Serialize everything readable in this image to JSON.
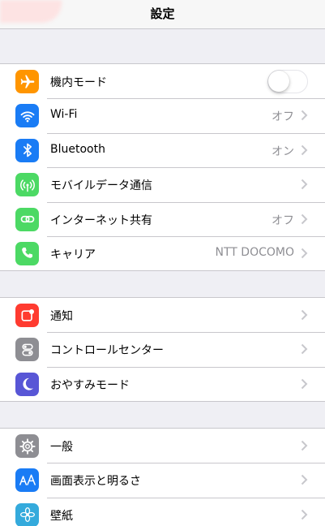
{
  "nav": {
    "title": "設定"
  },
  "colors": {
    "orange": "#ff9500",
    "blue": "#1a7cf5",
    "green": "#4cd964",
    "red": "#ff3b30",
    "gray": "#8e8e93",
    "purple": "#5856d6",
    "group_bg": "#efeff4",
    "value_gray": "#8e8e93"
  },
  "groups": [
    {
      "rows": [
        {
          "label": "機内モード",
          "icon": "airplane-icon",
          "control": "toggle",
          "toggle_on": false
        },
        {
          "label": "Wi-Fi",
          "icon": "wifi-icon",
          "value": "オフ"
        },
        {
          "label": "Bluetooth",
          "icon": "bluetooth-icon",
          "value": "オン"
        },
        {
          "label": "モバイルデータ通信",
          "icon": "antenna-icon",
          "value": ""
        },
        {
          "label": "インターネット共有",
          "icon": "link-icon",
          "value": "オフ"
        },
        {
          "label": "キャリア",
          "icon": "phone-icon",
          "value": "NTT DOCOMO"
        }
      ]
    },
    {
      "rows": [
        {
          "label": "通知",
          "icon": "notification-icon",
          "value": ""
        },
        {
          "label": "コントロールセンター",
          "icon": "switches-icon",
          "value": ""
        },
        {
          "label": "おやすみモード",
          "icon": "moon-icon",
          "value": ""
        }
      ]
    },
    {
      "rows": [
        {
          "label": "一般",
          "icon": "gear-icon",
          "value": ""
        },
        {
          "label": "画面表示と明るさ",
          "icon": "text-size-icon",
          "value": ""
        },
        {
          "label": "壁紙",
          "icon": "flower-icon",
          "value": ""
        }
      ]
    }
  ]
}
